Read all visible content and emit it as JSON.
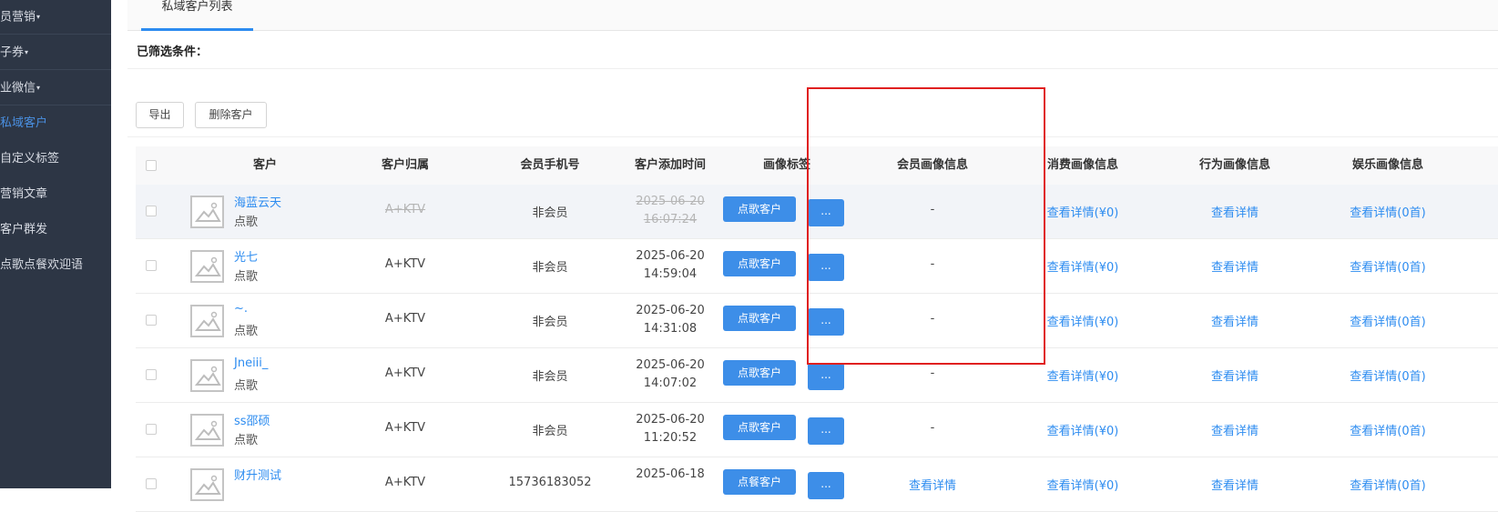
{
  "sidebar": {
    "items": [
      {
        "label": "员营销",
        "caret": "▾"
      },
      {
        "label": "子券",
        "caret": "▾"
      },
      {
        "label": "业微信",
        "caret": "▾"
      },
      {
        "label": "私域客户"
      },
      {
        "label": "自定义标签"
      },
      {
        "label": "营销文章"
      },
      {
        "label": "客户群发"
      },
      {
        "label": "点歌点餐欢迎语"
      }
    ]
  },
  "tabs": [
    {
      "label": "私域客户列表"
    }
  ],
  "filter_label": "已筛选条件：",
  "toolbar": {
    "export_label": "导出",
    "delete_label": "删除客户"
  },
  "table": {
    "headers": [
      "客户",
      "客户归属",
      "会员手机号",
      "客户添加时间",
      "画像标签",
      "会员画像信息",
      "消费画像信息",
      "行为画像信息",
      "娱乐画像信息"
    ],
    "rows": [
      {
        "name": "海蓝云天",
        "sub": "点歌",
        "store": "A+KTV",
        "phone": "非会员",
        "date": "2025-06-20",
        "time": "16:07:24",
        "tag_btn": "点歌客户",
        "more_btn": "...",
        "member": "-",
        "consume": "查看详情(¥0)",
        "behavior": "查看详情",
        "entertain": "查看详情(0首)"
      },
      {
        "name": "光七",
        "sub": "点歌",
        "store": "A+KTV",
        "phone": "非会员",
        "date": "2025-06-20",
        "time": "14:59:04",
        "tag_btn": "点歌客户",
        "more_btn": "...",
        "member": "-",
        "consume": "查看详情(¥0)",
        "behavior": "查看详情",
        "entertain": "查看详情(0首)"
      },
      {
        "name": "~.",
        "sub": "点歌",
        "store": "A+KTV",
        "phone": "非会员",
        "date": "2025-06-20",
        "time": "14:31:08",
        "tag_btn": "点歌客户",
        "more_btn": "...",
        "member": "-",
        "consume": "查看详情(¥0)",
        "behavior": "查看详情",
        "entertain": "查看详情(0首)"
      },
      {
        "name": "Jneiii_",
        "sub": "点歌",
        "store": "A+KTV",
        "phone": "非会员",
        "date": "2025-06-20",
        "time": "14:07:02",
        "tag_btn": "点歌客户",
        "more_btn": "...",
        "member": "-",
        "consume": "查看详情(¥0)",
        "behavior": "查看详情",
        "entertain": "查看详情(0首)"
      },
      {
        "name": "ss邵硕",
        "sub": "点歌",
        "store": "A+KTV",
        "phone": "非会员",
        "date": "2025-06-20",
        "time": "11:20:52",
        "tag_btn": "点歌客户",
        "more_btn": "...",
        "member": "-",
        "consume": "查看详情(¥0)",
        "behavior": "查看详情",
        "entertain": "查看详情(0首)"
      },
      {
        "name": "财升测试",
        "sub": "",
        "store": "A+KTV",
        "phone": "15736183052",
        "date": "2025-06-18",
        "time": "",
        "tag_btn": "点餐客户",
        "more_btn": "...",
        "member": "查看详情",
        "consume": "查看详情(¥0)",
        "behavior": "查看详情",
        "entertain": "查看详情(0首)"
      }
    ]
  },
  "colors": {
    "accent": "#2d8cf0",
    "button": "#3d8ee8",
    "sidebar": "#2d3645",
    "highlight_box": "#e02020"
  },
  "icons": {
    "avatar": "image-placeholder-icon"
  }
}
